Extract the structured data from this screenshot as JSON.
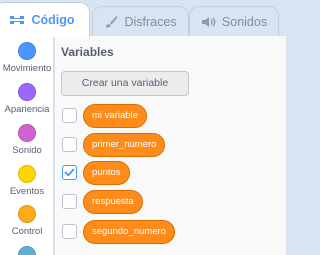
{
  "tabs": [
    {
      "label": "Código",
      "icon": "code-icon",
      "active": true
    },
    {
      "label": "Disfraces",
      "icon": "brush-icon",
      "active": false
    },
    {
      "label": "Sonidos",
      "icon": "speaker-icon",
      "active": false
    }
  ],
  "categories": [
    {
      "label": "Movimiento",
      "color": "#4c97ff"
    },
    {
      "label": "Apariencia",
      "color": "#9966ff"
    },
    {
      "label": "Sonido",
      "color": "#cf63cf"
    },
    {
      "label": "Eventos",
      "color": "#ffd500"
    },
    {
      "label": "Control",
      "color": "#ffab19"
    },
    {
      "label": "",
      "color": "#5cb1d6"
    }
  ],
  "palette": {
    "title": "Variables",
    "make_variable_label": "Crear una variable",
    "variables": [
      {
        "name": "mi variable",
        "checked": false
      },
      {
        "name": "primer_numero",
        "checked": false
      },
      {
        "name": "puntos",
        "checked": true
      },
      {
        "name": "respuesta",
        "checked": false
      },
      {
        "name": "segundo_numero",
        "checked": false
      }
    ]
  },
  "colors": {
    "accent": "#4c97ff",
    "variable_block": "#ff8c1a",
    "variable_block_border": "#db6e00"
  }
}
